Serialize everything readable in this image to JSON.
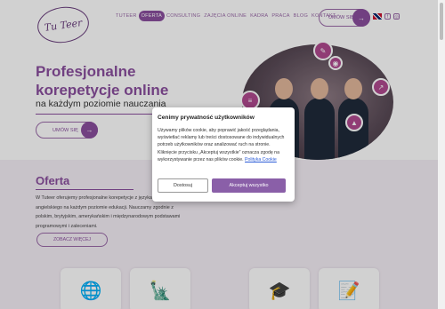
{
  "header": {
    "logo_text": "Tu Teer",
    "nav": [
      {
        "label": "TUTEER"
      },
      {
        "label": "OFERTA"
      },
      {
        "label": "CONSULTING"
      },
      {
        "label": "ZAJĘCIA ONLINE"
      },
      {
        "label": "KADRA"
      },
      {
        "label": "PRACA"
      },
      {
        "label": "BLOG"
      },
      {
        "label": "KONTAKT"
      }
    ],
    "cta_label": "UMÓW SIĘ",
    "icons": [
      "uk-flag-icon",
      "facebook-icon",
      "instagram-icon"
    ]
  },
  "hero": {
    "title_line1": "Profesjonalne",
    "title_line2": "korepetycje online",
    "subtitle": "na każdym poziomie nauczania",
    "cta_label": "UMÓW SIĘ"
  },
  "offer": {
    "title": "Oferta",
    "text": "W Tuteer oferujemy profesjonalne korepetycje z języka polskiego i angielskiego na każdym poziomie edukacji. Nauczamy zgodnie z polskim, brytyjskim, amerykańskim i międzynarodowym podstawami programowymi i zaleceniami.",
    "button_label": "ZOBACZ WIĘCEJ",
    "cards": [
      "globe-icon",
      "statue-icon",
      "graduation-cap-icon",
      "document-pen-icon"
    ]
  },
  "cookie_modal": {
    "title": "Cenimy prywatność użytkowników",
    "body": "Używamy plików cookie, aby poprawić jakość przeglądania, wyświetlać reklamy lub treści dostosowane do indywidualnych potrzeb użytkowników oraz analizować ruch na stronie. Kliknięcie przycisku „Akceptuj wszystkie” oznacza zgodę na wykorzystywanie przez nas plików cookie.",
    "policy_link": "Polityka Cookie",
    "decline_label": "Dostosuj",
    "accept_label": "Akceptuj wszystko"
  },
  "colors": {
    "brand": "#8a4f9e",
    "accept": "#8a5fa8"
  }
}
